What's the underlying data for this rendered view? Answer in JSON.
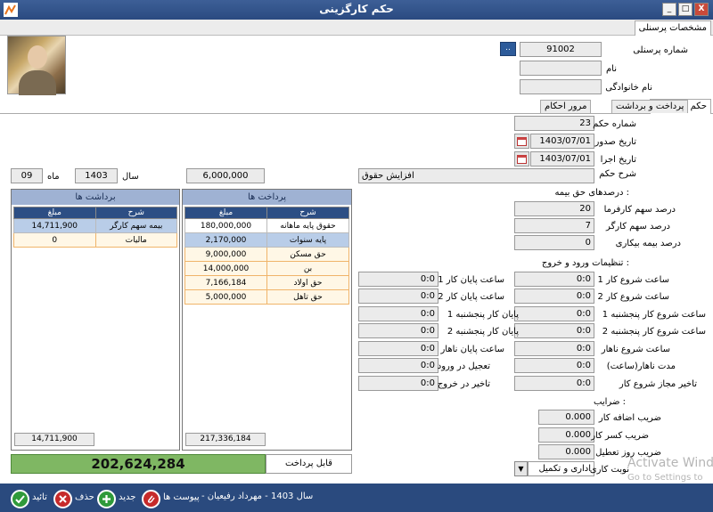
{
  "window": {
    "title": "حکم کارگزینی",
    "minimize": "_",
    "restore": "□",
    "close": "X"
  },
  "top_tab": "مشخصات پرسنلی",
  "personnel": {
    "code_label": "شماره پرسنلی",
    "code_value": "91002",
    "browse_label": "..",
    "name_label": "نام",
    "name_value": "",
    "family_label": "نام خانوادگی",
    "family_value": ""
  },
  "inner_tabs": [
    "حکم کارگزینی",
    "پرداخت و برداشت",
    "مرور احکام"
  ],
  "decree": {
    "number_label": "شماره حکم",
    "number_value": "23",
    "issue_label": "تاریخ صدور",
    "issue_value": "1403/07/01",
    "exec_label": "تاریخ اجرا",
    "exec_value": "1403/07/01",
    "desc_label": "شرح حکم",
    "desc_value": "افزایش حقوق",
    "amount_value": "6,000,000",
    "year_label": "سال",
    "year_value": "1403",
    "month_label": "ماه",
    "month_value": "09"
  },
  "insurance": {
    "section_label": "درصدهای حق بیمه :",
    "employer_label": "درصد سهم کارفرما",
    "employer_value": "20",
    "worker_label": "درصد سهم کارگر",
    "worker_value": "7",
    "unemployment_label": "درصد بیمه بیکاری",
    "unemployment_value": "0"
  },
  "timing": {
    "section_label": "تنظیمات ورود و خروج :",
    "right_rows": [
      {
        "label": "ساعت شروع کار 1",
        "value": "0:0"
      },
      {
        "label": "ساعت شروع کار 2",
        "value": "0:0"
      },
      {
        "label": "ساعت شروع کار پنجشنبه 1",
        "value": "0:0"
      },
      {
        "label": "ساعت شروع کار پنجشنبه 2",
        "value": "0:0"
      },
      {
        "label": "ساعت شروع ناهار",
        "value": "0:0"
      },
      {
        "label": "مدت ناهار(ساعت)",
        "value": "0:0"
      },
      {
        "label": "تاخیر مجاز شروع کار",
        "value": "0:0"
      }
    ],
    "left_rows": [
      {
        "label": "ساعت پایان کار 1",
        "value": "0:0"
      },
      {
        "label": "ساعت پایان کار 2",
        "value": "0:0"
      },
      {
        "label": "پایان کار پنجشنبه 1",
        "value": "0:0"
      },
      {
        "label": "پایان کار پنجشنبه 2",
        "value": "0:0"
      },
      {
        "label": "ساعت پایان ناهار",
        "value": "0:0"
      },
      {
        "label": "تعجیل در ورود",
        "value": "0:0"
      },
      {
        "label": "تاخیر در خروج",
        "value": "0:0"
      }
    ]
  },
  "coefficients": {
    "section_label": "ضرایب :",
    "overtime_label": "ضریب اضافه کار",
    "overtime_value": "0.000",
    "deficit_label": "ضریب کسر کار",
    "deficit_value": "0.000",
    "holiday_label": "ضریب روز تعطیل",
    "holiday_value": "0.000"
  },
  "shift": {
    "label": "نوبت کاری",
    "value": "اداری و تکمیل",
    "arrow": "▼"
  },
  "payments": {
    "title": "پرداخت ها",
    "col_desc": "شرح",
    "col_amount": "مبلغ",
    "rows": [
      {
        "desc": "حقوق پایه ماهانه",
        "amount": "180,000,000"
      },
      {
        "desc": "پایه سنوات",
        "amount": "2,170,000"
      },
      {
        "desc": "حق مسکن",
        "amount": "9,000,000"
      },
      {
        "desc": "بن",
        "amount": "14,000,000"
      },
      {
        "desc": "حق اولاد",
        "amount": "7,166,184"
      },
      {
        "desc": "حق تاهل",
        "amount": "5,000,000"
      }
    ],
    "total": "217,336,184"
  },
  "deductions": {
    "title": "برداشت ها",
    "col_desc": "شرح",
    "col_amount": "مبلغ",
    "rows": [
      {
        "desc": "بیمه سهم کارگر",
        "amount": "14,711,900"
      },
      {
        "desc": "مالیات",
        "amount": "0"
      }
    ],
    "total": "14,711,900"
  },
  "net": {
    "label": "قابل پرداخت",
    "value": "202,624,284"
  },
  "watermark": {
    "line1": "Activate Windo",
    "line2": "Go to Settings to"
  },
  "bottom": {
    "confirm": "تائید",
    "delete": "حذف",
    "new": "جدید",
    "attachments": "پیوست ها",
    "status": "- سال 1403 - مهرداد رفیعیان"
  },
  "colors": {
    "title_bar": "#2f5289",
    "net_green": "#7fb763",
    "grid_header": "#2c4e84",
    "bottom_bar": "#2a4a7e"
  }
}
